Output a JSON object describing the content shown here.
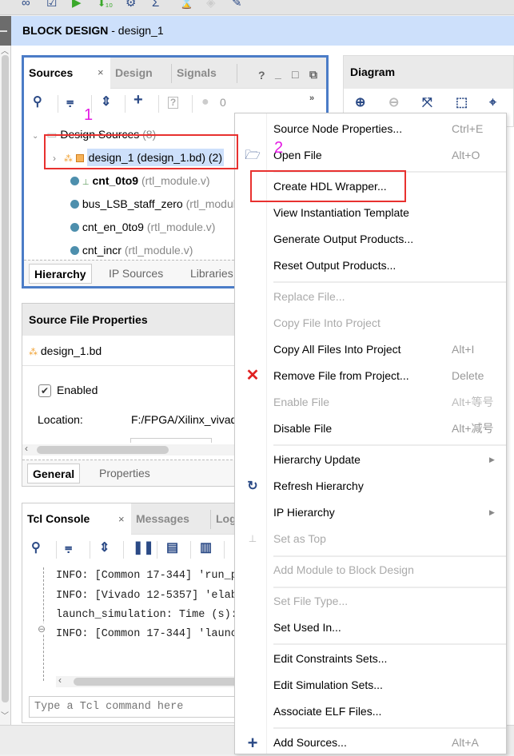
{
  "toolbar": {
    "icons": [
      "binoculars-icon",
      "checklist-icon",
      "run-icon",
      "step-icon",
      "gear-icon",
      "sigma-icon",
      "disabled-icon",
      "disabled-tag-icon",
      "tools-icon"
    ]
  },
  "header": {
    "title_bold": "BLOCK DESIGN",
    "title_rest": " - design_1"
  },
  "sources_panel": {
    "tabs": [
      {
        "label": "Sources",
        "active": true
      },
      {
        "label": "Design",
        "active": false
      },
      {
        "label": "Signals",
        "active": false
      }
    ],
    "close_glyph": "×",
    "controls": [
      "?",
      "_",
      "□",
      "⧉"
    ],
    "toolbar_count": "0",
    "overflow": "»",
    "tree": {
      "root_label": "Design Sources",
      "root_count": "(8)",
      "items": [
        {
          "name": "design_1",
          "detail": "(design_1.bd) (2)",
          "selected": true
        },
        {
          "name": "cnt_0to9",
          "detail": "(rtl_module.v)",
          "bold": true
        },
        {
          "name": "bus_LSB_staff_zero",
          "detail": "(rtl_module.v)"
        },
        {
          "name": "cnt_en_0to9",
          "detail": "(rtl_module.v)"
        },
        {
          "name": "cnt_incr",
          "detail": "(rtl_module.v)"
        }
      ]
    },
    "bottom_tabs": [
      {
        "label": "Hierarchy",
        "active": true
      },
      {
        "label": "IP Sources",
        "active": false
      },
      {
        "label": "Libraries",
        "active": false
      }
    ]
  },
  "source_file_properties": {
    "title": "Source File Properties",
    "file": "design_1.bd",
    "enabled_label": "Enabled",
    "enabled": true,
    "location_label": "Location:",
    "location_value": "F:/FPGA/Xilinx_vivado",
    "bottom_tabs": [
      {
        "label": "General",
        "active": true
      },
      {
        "label": "Properties",
        "active": false
      }
    ]
  },
  "diagram_panel": {
    "title": "Diagram"
  },
  "tcl_console": {
    "tabs": [
      {
        "label": "Tcl Console",
        "active": true
      },
      {
        "label": "Messages",
        "active": false
      },
      {
        "label": "Log",
        "active": false
      }
    ],
    "lines": [
      "INFO: [Common 17-344] 'run_p",
      "INFO: [Vivado 12-5357] 'elab",
      "launch_simulation: Time (s):",
      "INFO: [Common 17-344] 'launc"
    ],
    "input_placeholder": "Type a Tcl command here"
  },
  "context_menu": {
    "items": [
      {
        "label": "Source Node Properties...",
        "shortcut": "Ctrl+E",
        "enabled": true
      },
      {
        "label": "Open File",
        "shortcut": "Alt+O",
        "enabled": true,
        "icon": "folder-icon"
      },
      {
        "separator": true
      },
      {
        "label": "Create HDL Wrapper...",
        "enabled": true,
        "highlighted_box": true
      },
      {
        "label": "View Instantiation Template",
        "enabled": true
      },
      {
        "label": "Generate Output Products...",
        "enabled": true
      },
      {
        "label": "Reset Output Products...",
        "enabled": true
      },
      {
        "separator": true
      },
      {
        "label": "Replace File...",
        "enabled": false
      },
      {
        "label": "Copy File Into Project",
        "enabled": false
      },
      {
        "label": "Copy All Files Into Project",
        "shortcut": "Alt+I",
        "enabled": true
      },
      {
        "label": "Remove File from Project...",
        "shortcut": "Delete",
        "enabled": true,
        "icon": "remove-icon"
      },
      {
        "label": "Enable File",
        "shortcut": "Alt+等号",
        "enabled": false
      },
      {
        "label": "Disable File",
        "shortcut": "Alt+减号",
        "enabled": true
      },
      {
        "separator": true
      },
      {
        "label": "Hierarchy Update",
        "enabled": true,
        "submenu": true
      },
      {
        "label": "Refresh Hierarchy",
        "enabled": true,
        "icon": "refresh-icon"
      },
      {
        "label": "IP Hierarchy",
        "enabled": true,
        "submenu": true
      },
      {
        "label": "Set as Top",
        "enabled": false,
        "icon": "hierarchy-icon"
      },
      {
        "separator": true
      },
      {
        "label": "Add Module to Block Design",
        "enabled": false
      },
      {
        "separator": true
      },
      {
        "label": "Set File Type...",
        "enabled": false
      },
      {
        "label": "Set Used In...",
        "enabled": true
      },
      {
        "separator": true
      },
      {
        "label": "Edit Constraints Sets...",
        "enabled": true
      },
      {
        "label": "Edit Simulation Sets...",
        "enabled": true
      },
      {
        "label": "Associate ELF Files...",
        "enabled": true
      },
      {
        "separator": true
      },
      {
        "label": "Add Sources...",
        "shortcut": "Alt+A",
        "enabled": true,
        "icon": "plus-icon"
      }
    ]
  },
  "annotations": {
    "step1": "1",
    "step2": "2",
    "color": "#e31ae3",
    "box_color": "#e8312f"
  },
  "colors": {
    "panel_border_active": "#4b7cc7",
    "header_bg": "#cde0fb",
    "icon_blue": "#2b4a86"
  }
}
